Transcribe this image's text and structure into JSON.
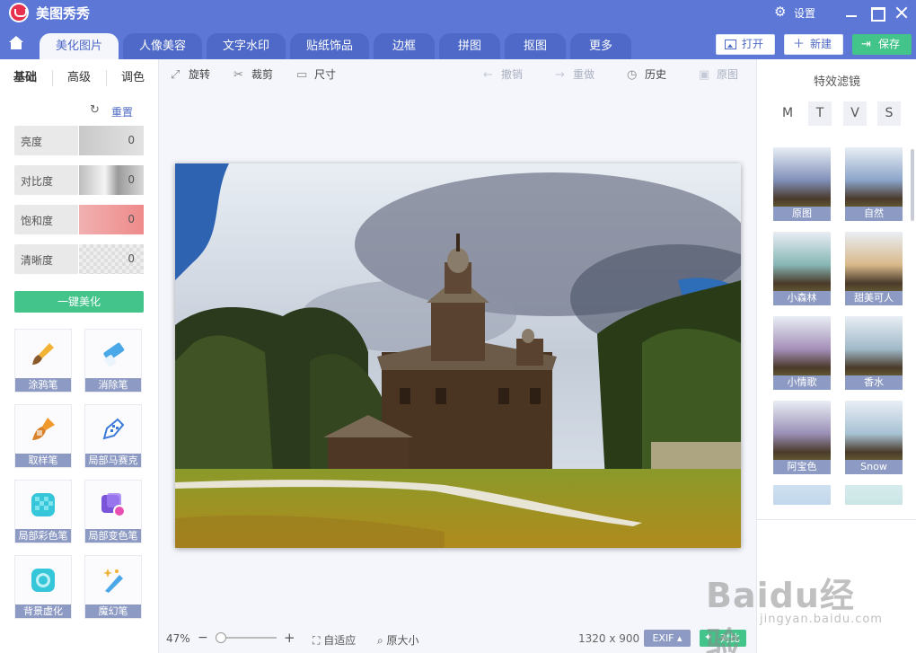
{
  "window": {
    "title": "美图秀秀",
    "settings_label": "设置"
  },
  "nav": {
    "tabs": [
      {
        "label": "美化图片",
        "active": true
      },
      {
        "label": "人像美容"
      },
      {
        "label": "文字水印"
      },
      {
        "label": "贴纸饰品"
      },
      {
        "label": "边框"
      },
      {
        "label": "拼图"
      },
      {
        "label": "抠图"
      },
      {
        "label": "更多"
      }
    ],
    "open_label": "打开",
    "new_label": "新建",
    "save_label": "保存"
  },
  "left_panel": {
    "tabs": [
      "基础",
      "高级",
      "调色"
    ],
    "reset_label": "重置",
    "sliders": [
      {
        "label": "亮度",
        "value": "0"
      },
      {
        "label": "对比度",
        "value": "0"
      },
      {
        "label": "饱和度",
        "value": "0"
      },
      {
        "label": "清晰度",
        "value": "0"
      }
    ],
    "one_click_label": "一键美化",
    "tools": [
      {
        "label": "涂鸦笔",
        "icon": "brush-icon"
      },
      {
        "label": "消除笔",
        "icon": "eraser-icon"
      },
      {
        "label": "取样笔",
        "icon": "sample-brush-icon"
      },
      {
        "label": "局部马赛克",
        "icon": "mosaic-pen-icon"
      },
      {
        "label": "局部彩色笔",
        "icon": "color-pen-icon"
      },
      {
        "label": "局部变色笔",
        "icon": "recolor-pen-icon"
      },
      {
        "label": "背景虚化",
        "icon": "blur-background-icon"
      },
      {
        "label": "魔幻笔",
        "icon": "magic-pen-icon"
      }
    ]
  },
  "toolbar": {
    "rotate_label": "旋转",
    "crop_label": "裁剪",
    "size_label": "尺寸",
    "undo_label": "撤销",
    "redo_label": "重做",
    "history_label": "历史",
    "original_label": "原图"
  },
  "status": {
    "zoom": "47%",
    "fit_label": "自适应",
    "actual_size_label": "原大小",
    "dimensions": "1320 x 900",
    "exif_label": "EXIF",
    "compare_label": "对比",
    "zoom_level": 0.06
  },
  "right_panel": {
    "title": "特效滤镜",
    "filter_tabs": [
      "M",
      "T",
      "V",
      "S"
    ],
    "filters": [
      {
        "label": "原图",
        "tint": "#7f8fb8"
      },
      {
        "label": "自然",
        "tint": "#8aa4c9"
      },
      {
        "label": "小森林",
        "tint": "#86b6b4"
      },
      {
        "label": "甜美可人",
        "tint": "#d8b98a"
      },
      {
        "label": "小情歌",
        "tint": "#a48fb8"
      },
      {
        "label": "香水",
        "tint": "#9fb9c8"
      },
      {
        "label": "阿宝色",
        "tint": "#9a8fb6"
      },
      {
        "label": "Snow",
        "tint": "#a8c2d4"
      }
    ]
  },
  "watermark": {
    "main": "Baidu经验",
    "sub": "jingyan.baidu.com"
  },
  "colors": {
    "accent": "#5c77d6",
    "green": "#42c48a",
    "label_bg": "#8d9bc4"
  }
}
